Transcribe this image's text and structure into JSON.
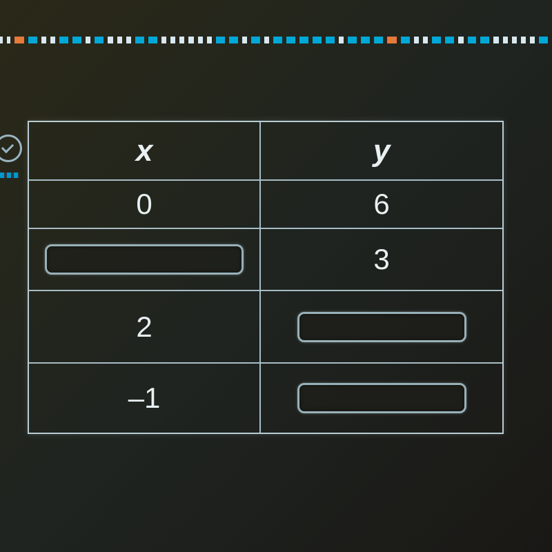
{
  "table": {
    "headers": {
      "x": "x",
      "y": "y"
    },
    "rows": [
      {
        "x": "0",
        "y": "6",
        "x_input": false,
        "y_input": false
      },
      {
        "x": "",
        "y": "3",
        "x_input": true,
        "y_input": false
      },
      {
        "x": "2",
        "y": "",
        "x_input": false,
        "y_input": true
      },
      {
        "x": "–1",
        "y": "",
        "x_input": false,
        "y_input": true
      }
    ]
  }
}
